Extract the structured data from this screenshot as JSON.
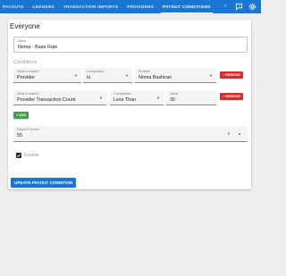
{
  "nav": {
    "tabs": [
      {
        "label": "PAYOUTS",
        "active": false
      },
      {
        "label": "LEDGERS",
        "active": false
      },
      {
        "label": "TRANSACTION IMPORTS",
        "active": false
      },
      {
        "label": "PROVIDERS",
        "active": false
      },
      {
        "label": "PAYOUT CONDITIONS",
        "active": true
      }
    ],
    "more_icon": "chevron-right-icon",
    "actions": [
      "chat-icon",
      "settings-icon"
    ]
  },
  "card": {
    "title": "Everyone",
    "name_field": {
      "label": "Name",
      "value": "Noma - Base Rate"
    },
    "conditions_label": "Conditions",
    "conditions": [
      {
        "what": {
          "label": "What to match?",
          "value": "Provider"
        },
        "comparison": {
          "label": "Comparison",
          "value": "Is"
        },
        "target": {
          "label": "Provider",
          "value": "Noma Bashiran"
        },
        "remove_label": "REMOVE"
      },
      {
        "what": {
          "label": "What to match?",
          "value": "Provider Transaction Count"
        },
        "comparison": {
          "label": "Comparison",
          "value": "Less Than"
        },
        "target": {
          "label": "Value",
          "value": "30"
        },
        "remove_label": "REMOVE"
      }
    ],
    "add_label": "ADD",
    "payout_percent": {
      "label": "Payout Percent",
      "value": "55"
    },
    "enable": {
      "label": "Enable",
      "checked": true
    },
    "update_label": "UPDATE PAYOUT CONDITION"
  },
  "colors": {
    "primary": "#1976d2",
    "danger": "#d32f2f",
    "success": "#43a047"
  }
}
